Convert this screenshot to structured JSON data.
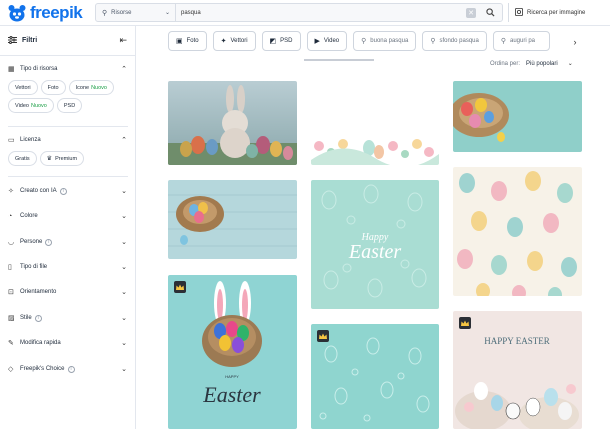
{
  "brand": {
    "name": "freepik",
    "color": "#1273eb"
  },
  "search": {
    "resource_type": "Risorse",
    "query": "pasqua",
    "image_search_label": "Ricerca per immagine",
    "icon": "search-icon"
  },
  "sidebar": {
    "title": "Filtri",
    "resource_type": {
      "title": "Tipo di risorsa",
      "chips": [
        {
          "label": "Vettori",
          "badge": ""
        },
        {
          "label": "Foto",
          "badge": ""
        },
        {
          "label": "Icone",
          "badge": "Nuovo"
        },
        {
          "label": "Video",
          "badge": "Nuovo"
        },
        {
          "label": "PSD",
          "badge": ""
        }
      ]
    },
    "license": {
      "title": "Licenza",
      "chips": [
        {
          "label": "Gratis"
        },
        {
          "label": "Premium"
        }
      ]
    },
    "sections": [
      {
        "label": "Creato con IA",
        "info": true
      },
      {
        "label": "Colore",
        "info": false
      },
      {
        "label": "Persone",
        "info": true
      },
      {
        "label": "Tipo di file",
        "info": false
      },
      {
        "label": "Orientamento",
        "info": false
      },
      {
        "label": "Stile",
        "info": true
      },
      {
        "label": "Modifica rapida",
        "info": false
      },
      {
        "label": "Freepik's Choice",
        "info": true
      }
    ]
  },
  "filters": {
    "tabs": [
      {
        "label": "Foto",
        "icon": "photo-icon"
      },
      {
        "label": "Vettori",
        "icon": "vector-icon"
      },
      {
        "label": "PSD",
        "icon": "psd-icon"
      },
      {
        "label": "Video",
        "icon": "video-icon"
      }
    ],
    "suggestions": [
      "buona pasqua",
      "sfondo pasqua",
      "auguri pa"
    ]
  },
  "sort": {
    "label": "Ordina per:",
    "value": "Più popolari"
  },
  "results": {
    "images": [
      {
        "name": "bunny-eggs-photo",
        "premium": false
      },
      {
        "name": "floral-eggs-border",
        "premium": false
      },
      {
        "name": "basket-eggs-teal",
        "premium": false
      },
      {
        "name": "nest-eggs-wood",
        "premium": false
      },
      {
        "name": "happy-easter-pattern",
        "premium": false
      },
      {
        "name": "easter-eggs-pattern",
        "premium": false
      },
      {
        "name": "bunny-ears-basket-poster",
        "premium": true
      },
      {
        "name": "mint-doodle-pattern",
        "premium": true
      },
      {
        "name": "happy-easter-card",
        "premium": true
      }
    ],
    "texts": {
      "happy": "Happy",
      "easter": "Easter",
      "poster_happy": "HAPPY",
      "poster_easter": "Easter",
      "card": "HAPPY EASTER"
    }
  }
}
